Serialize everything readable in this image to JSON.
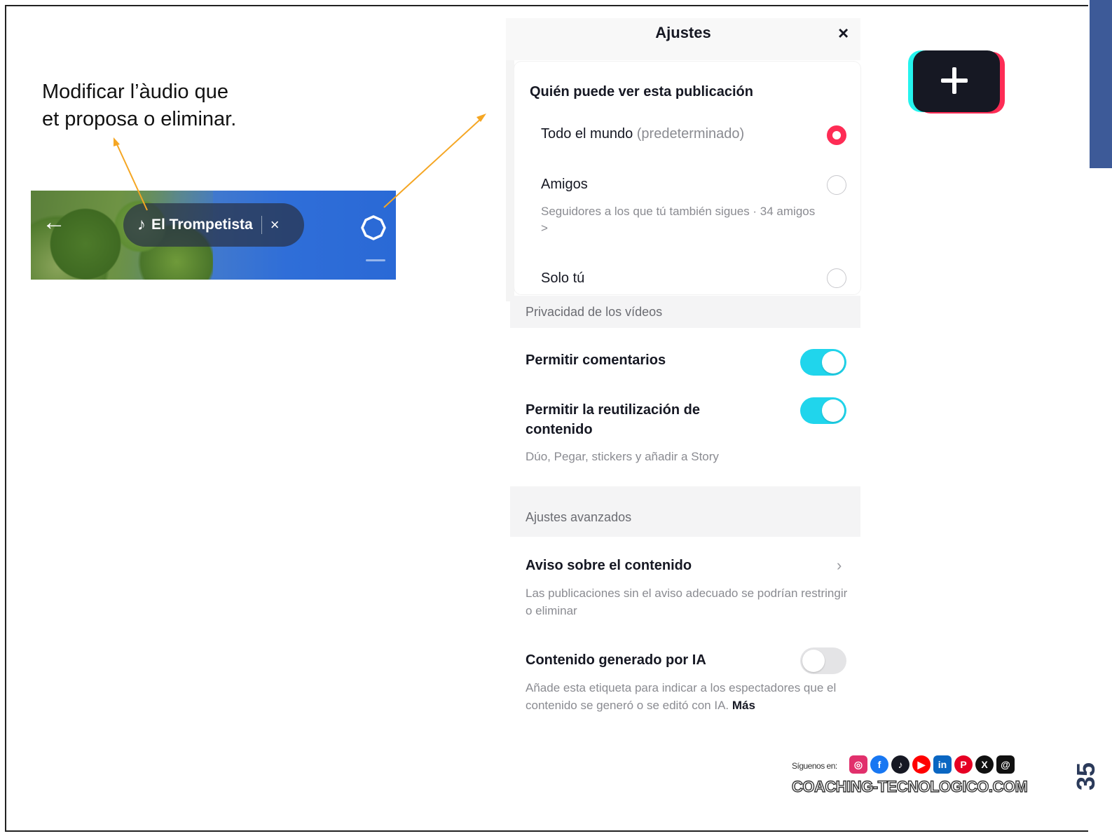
{
  "caption": {
    "line1": "Modificar l’àudio que",
    "line2": "et proposa o eliminar."
  },
  "thumbnail": {
    "back_icon": "arrow-left-icon",
    "sound_name": "El Trompetista",
    "note_glyph": "♪",
    "remove_glyph": "×",
    "settings_icon": "gear-icon"
  },
  "settings": {
    "title": "Ajustes",
    "close_glyph": "×",
    "who_can_view": {
      "title": "Quién puede ver esta publicación",
      "options": [
        {
          "label": "Todo el mundo",
          "note": "(predeterminado)",
          "selected": true
        },
        {
          "label": "Amigos",
          "sub": "Seguidores a los que tú también sigues · 34 amigos >",
          "selected": false
        },
        {
          "label": "Solo tú",
          "selected": false
        }
      ]
    },
    "video_privacy_label": "Privacidad de los vídeos",
    "allow_comments": {
      "label": "Permitir comentarios",
      "enabled": true
    },
    "allow_reuse": {
      "label": "Permitir la reutilización de contenido",
      "sub": "Dúo, Pegar, stickers y añadir a Story",
      "enabled": true
    },
    "advanced_label": "Ajustes avanzados",
    "content_disclosure": {
      "label": "Aviso sobre el contenido",
      "sub": "Las publicaciones sin el aviso adecuado se podrían restringir o eliminar",
      "chevron": "›"
    },
    "ai_generated": {
      "label": "Contenido generado por IA",
      "sub": "Añade esta etiqueta para indicar a los espectadores que el contenido se generó o se editó con IA.",
      "more": "Más",
      "enabled": false
    }
  },
  "footer": {
    "follow_label": "Síguenos en:",
    "site": "COACHING-TECNOLOGICO.COM",
    "social_icons": [
      "instagram-icon",
      "facebook-icon",
      "tiktok-icon",
      "youtube-icon",
      "linkedin-icon",
      "pinterest-icon",
      "x-icon",
      "threads-icon"
    ]
  },
  "page_number": "35",
  "colors": {
    "accent_red": "#fe2c55",
    "toggle_on": "#20d5ec",
    "arrow": "#f5a623",
    "side_accent": "#3d5a98"
  }
}
